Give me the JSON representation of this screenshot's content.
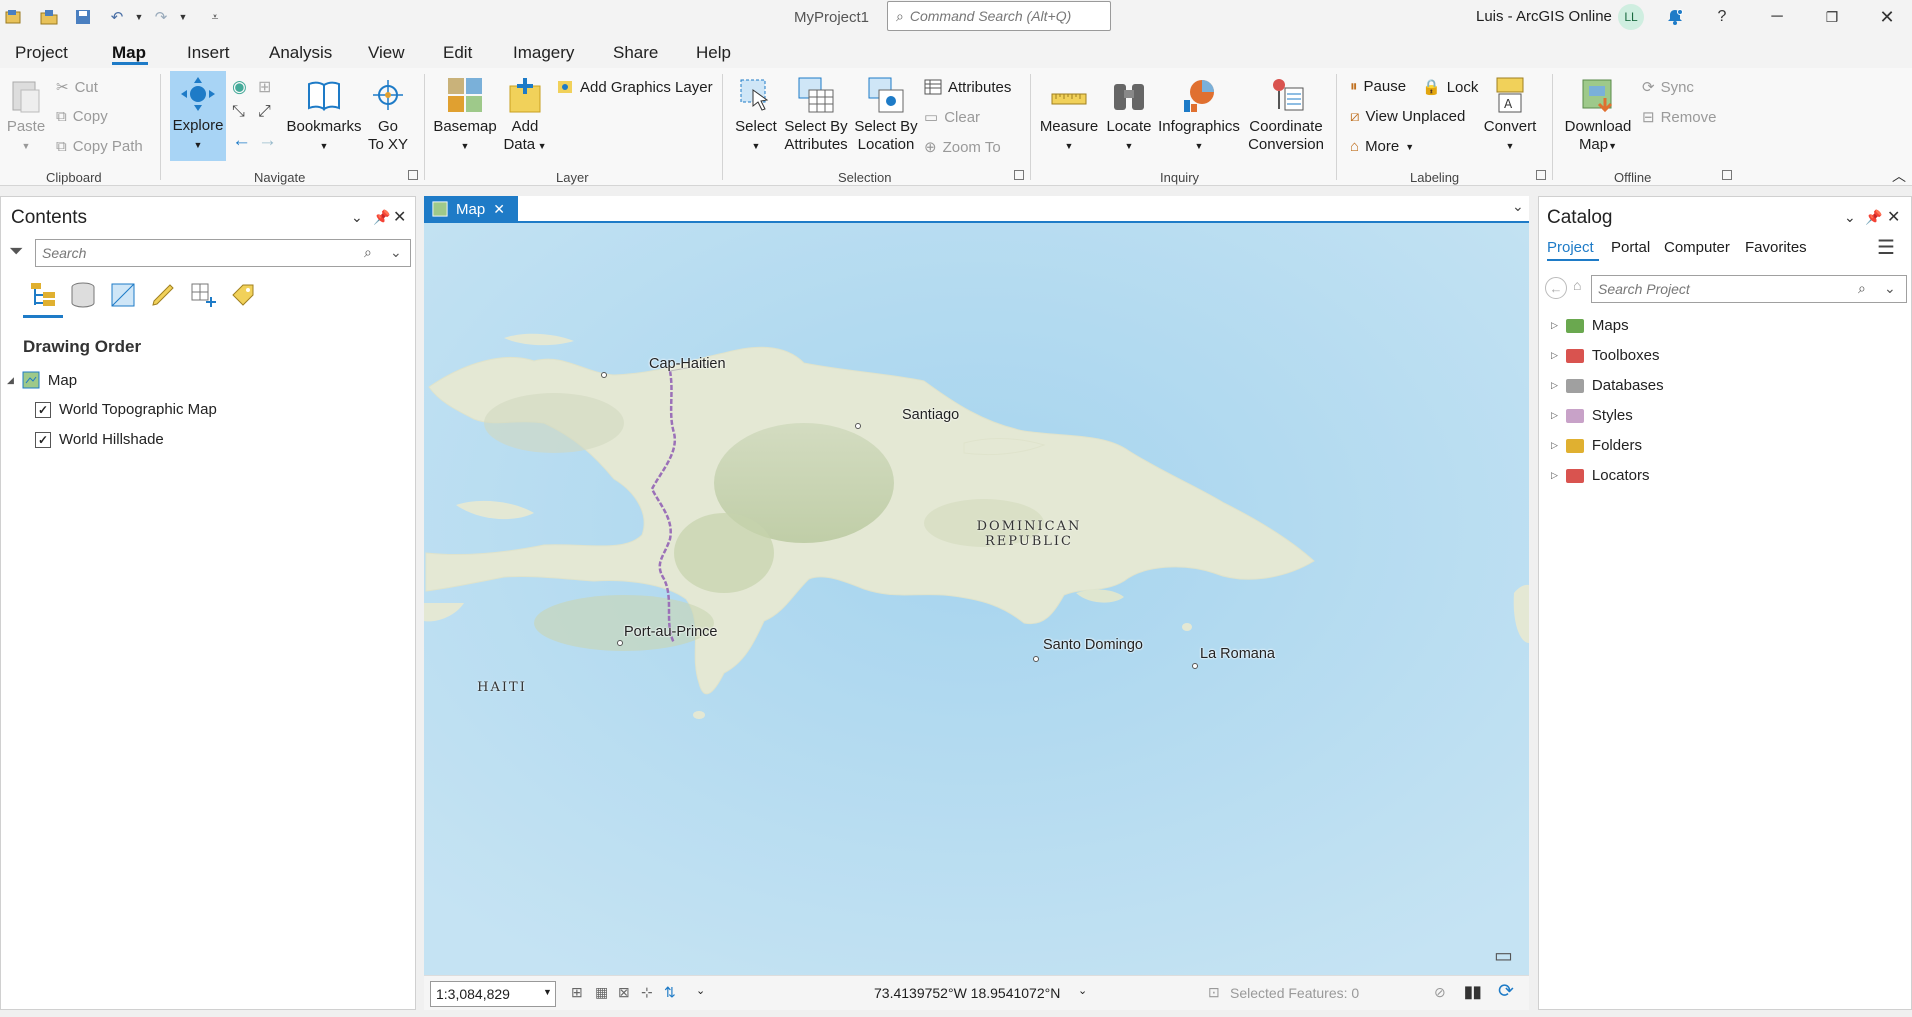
{
  "titlebar": {
    "project_name": "MyProject1",
    "command_search_placeholder": "Command Search (Alt+Q)",
    "user": "Luis - ArcGIS Online",
    "avatar_initials": "LL",
    "help": "?"
  },
  "menu": {
    "items": [
      "Project",
      "Map",
      "Insert",
      "Analysis",
      "View",
      "Edit",
      "Imagery",
      "Share",
      "Help"
    ],
    "active": "Map"
  },
  "ribbon": {
    "clipboard": {
      "group": "Clipboard",
      "paste": "Paste",
      "cut": "Cut",
      "copy": "Copy",
      "copy_path": "Copy Path"
    },
    "navigate": {
      "group": "Navigate",
      "explore": "Explore",
      "bookmarks": "Bookmarks",
      "go_to_xy_1": "Go",
      "go_to_xy_2": "To XY"
    },
    "layer": {
      "group": "Layer",
      "basemap": "Basemap",
      "add_data_1": "Add",
      "add_data_2": "Data",
      "add_graphics_layer": "Add Graphics Layer"
    },
    "selection": {
      "group": "Selection",
      "select": "Select",
      "select_by_attributes_1": "Select By",
      "select_by_attributes_2": "Attributes",
      "select_by_location_1": "Select By",
      "select_by_location_2": "Location",
      "attributes": "Attributes",
      "clear": "Clear",
      "zoom_to": "Zoom To"
    },
    "inquiry": {
      "group": "Inquiry",
      "measure": "Measure",
      "locate": "Locate",
      "infographics": "Infographics",
      "coord_1": "Coordinate",
      "coord_2": "Conversion"
    },
    "labeling": {
      "group": "Labeling",
      "pause": "Pause",
      "lock": "Lock",
      "view_unplaced": "View Unplaced",
      "more": "More",
      "convert": "Convert"
    },
    "offline": {
      "group": "Offline",
      "download_1": "Download",
      "download_2": "Map",
      "sync": "Sync",
      "remove": "Remove"
    }
  },
  "contents": {
    "title": "Contents",
    "search_placeholder": "Search",
    "drawing_order": "Drawing Order",
    "map_node": "Map",
    "layers": [
      {
        "name": "World Topographic Map",
        "checked": true
      },
      {
        "name": "World Hillshade",
        "checked": true
      }
    ]
  },
  "map_view": {
    "tab_label": "Map",
    "labels": {
      "cap_haitien": "Cap-Haitien",
      "santiago": "Santiago",
      "dominican_1": "DOMINICAN",
      "dominican_2": "REPUBLIC",
      "port_au_prince": "Port-au-Prince",
      "haiti": "HAITI",
      "santo_domingo": "Santo Domingo",
      "la_romana": "La Romana"
    },
    "status": {
      "scale": "1:3,084,829",
      "coordinates": "73.4139752°W 18.9541072°N",
      "selected_features": "Selected Features: 0"
    }
  },
  "catalog": {
    "title": "Catalog",
    "tabs": [
      "Project",
      "Portal",
      "Computer",
      "Favorites"
    ],
    "active_tab": "Project",
    "search_placeholder": "Search Project",
    "items": [
      {
        "label": "Maps",
        "icon": "maps-folder-icon",
        "color": "#6aa84f"
      },
      {
        "label": "Toolboxes",
        "icon": "toolbox-folder-icon",
        "color": "#d9534f"
      },
      {
        "label": "Databases",
        "icon": "database-folder-icon",
        "color": "#a0a0a0"
      },
      {
        "label": "Styles",
        "icon": "styles-folder-icon",
        "color": "#c8a2c8"
      },
      {
        "label": "Folders",
        "icon": "folder-icon",
        "color": "#e0b030"
      },
      {
        "label": "Locators",
        "icon": "locator-folder-icon",
        "color": "#d9534f"
      }
    ]
  },
  "colors": {
    "accent": "#1e7bc7",
    "water": "#b7dcef",
    "land": "#e7eadb"
  }
}
